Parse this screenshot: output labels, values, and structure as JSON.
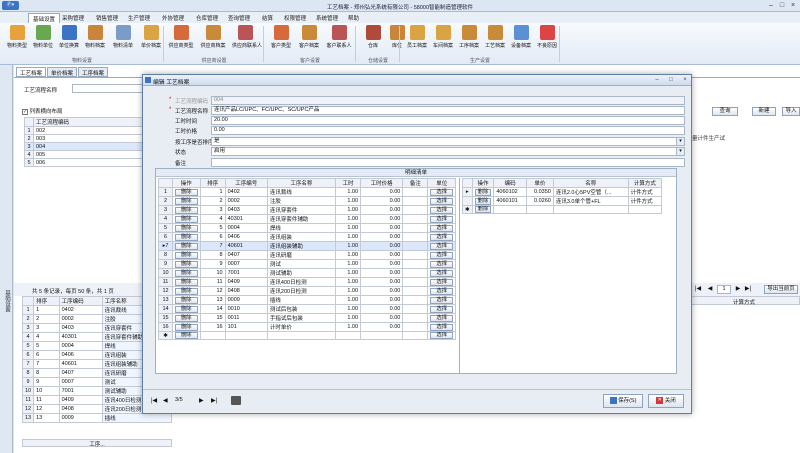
{
  "window": {
    "title": "工艺档案 - 郑州弘光系统有限公司 - 58000智能制造管理软件",
    "app_button": "Ⓟ▾"
  },
  "menubar": [
    {
      "label": "基础设置",
      "active": true
    },
    {
      "label": "采购管理"
    },
    {
      "label": "销售管理"
    },
    {
      "label": "生产管理"
    },
    {
      "label": "外协管理"
    },
    {
      "label": "仓库管理"
    },
    {
      "label": "查询管理"
    },
    {
      "label": "结算"
    },
    {
      "label": "权限管理"
    },
    {
      "label": "系统管理"
    },
    {
      "label": "帮助"
    }
  ],
  "ribbon": {
    "buttons": [
      {
        "label": "物料类型",
        "icon": "folder-icon",
        "color": "#e8a23a"
      },
      {
        "label": "物料单位",
        "icon": "unit-icon",
        "color": "#6aa84f"
      },
      {
        "label": "单位换算",
        "icon": "convert-icon",
        "color": "#3b74c4"
      },
      {
        "label": "物料档案",
        "icon": "archive-icon",
        "color": "#c9853a"
      },
      {
        "label": "物料清单",
        "icon": "list-icon",
        "color": "#7a9cc6"
      },
      {
        "label": "单价档案",
        "icon": "price-icon",
        "color": "#d9a441"
      },
      {
        "label": "供应商类型",
        "icon": "supplier-type-icon",
        "color": "#d66a3a"
      },
      {
        "label": "供应商档案",
        "icon": "supplier-icon",
        "color": "#c98a3a"
      },
      {
        "label": "供应商联系人",
        "icon": "contact-icon",
        "color": "#b55"
      },
      {
        "label": "客户类型",
        "icon": "customer-type-icon",
        "color": "#d66a3a"
      },
      {
        "label": "客户档案",
        "icon": "customer-icon",
        "color": "#c98a3a"
      },
      {
        "label": "客户联系人",
        "icon": "customer-contact-icon",
        "color": "#b55"
      },
      {
        "label": "仓库",
        "icon": "warehouse-icon",
        "color": "#b04a3a"
      },
      {
        "label": "库位",
        "icon": "location-icon",
        "color": "#c9853a"
      },
      {
        "label": "员工档案",
        "icon": "employee-icon",
        "color": "#d9a441"
      },
      {
        "label": "车间档案",
        "icon": "workshop-icon",
        "color": "#d9a441"
      },
      {
        "label": "工序档案",
        "icon": "process-icon",
        "color": "#c98a3a"
      },
      {
        "label": "工艺档案",
        "icon": "craft-icon",
        "color": "#c98a3a"
      },
      {
        "label": "设备档案",
        "icon": "equipment-icon",
        "color": "#5b8fd6"
      },
      {
        "label": "不良原因",
        "icon": "defect-icon",
        "color": "#d44"
      }
    ],
    "groups": [
      "物料设置",
      "供应商设置",
      "客户设置",
      "仓储设置",
      "生产设置"
    ]
  },
  "lefttab": "基础设置",
  "doc_tabs": [
    "工艺档案",
    "单价档案",
    "工序档案"
  ],
  "main": {
    "filter_label": "工艺流程名称",
    "show_all_label": "列表横向布局",
    "query_btn": "查询",
    "new_btn": "新建",
    "import_btn": "导入",
    "list_header": "工艺流程编码",
    "list_rows": [
      {
        "n": "1",
        "code": "002"
      },
      {
        "n": "2",
        "code": "003"
      },
      {
        "n": "3",
        "code": "004",
        "selected": true
      },
      {
        "n": "4",
        "code": "005"
      },
      {
        "n": "5",
        "code": "006"
      }
    ],
    "right_text": "量计件生产试",
    "pager_text": "共 5 条记录，每页 50 条，共 1 页",
    "page_num": "1",
    "export_btn": "导出当前页",
    "lower_headers": [
      "排序",
      "工序编码",
      "工序名称"
    ],
    "lower_rows": [
      {
        "n": "1",
        "seq": "1",
        "code": "0402",
        "name": "连讯裁线"
      },
      {
        "n": "2",
        "seq": "2",
        "code": "0002",
        "name": "注胶"
      },
      {
        "n": "3",
        "seq": "3",
        "code": "0403",
        "name": "连讯穿套件"
      },
      {
        "n": "4",
        "seq": "4",
        "code": "40301",
        "name": "连讯穿套件辅助"
      },
      {
        "n": "5",
        "seq": "5",
        "code": "0004",
        "name": "焊线"
      },
      {
        "n": "6",
        "seq": "6",
        "code": "0406",
        "name": "连讯组装"
      },
      {
        "n": "7",
        "seq": "7",
        "code": "40601",
        "name": "连讯组装辅助"
      },
      {
        "n": "8",
        "seq": "8",
        "code": "0407",
        "name": "连讯研磨"
      },
      {
        "n": "9",
        "seq": "9",
        "code": "0007",
        "name": "测试"
      },
      {
        "n": "10",
        "seq": "10",
        "code": "7001",
        "name": "测试辅助"
      },
      {
        "n": "11",
        "seq": "11",
        "code": "0409",
        "name": "连讯400日检测"
      },
      {
        "n": "12",
        "seq": "12",
        "code": "0408",
        "name": "连讯200日检测"
      },
      {
        "n": "13",
        "seq": "13",
        "code": "0009",
        "name": "插线"
      }
    ],
    "lower_right_header": "计算方式",
    "lower_footer": "工序..."
  },
  "modal": {
    "title": "编辑 工艺档案",
    "fields": {
      "code_label": "工艺流程编码",
      "code_value": "004",
      "name_label": "工艺流程名称",
      "name_value": "连讯产品LC/UPC、FC/UPC、SC/UPC产品",
      "time_label": "工时时间",
      "time_value": "20.00",
      "price_label": "工时价格",
      "price_value": "0.00",
      "sort_label": "按工序是否排序",
      "sort_value": "是",
      "status_label": "状态",
      "status_value": "启用",
      "remark_label": "备注",
      "remark_value": ""
    },
    "detail_title": "明细清单",
    "left_headers": [
      "操作",
      "排序",
      "工序编号",
      "工序名称",
      "工时",
      "工时价格",
      "备注",
      "单位"
    ],
    "left_rows": [
      {
        "n": "1",
        "op": "删除",
        "seq": "1",
        "code": "0402",
        "name": "连讯裁线",
        "hours": "1.00",
        "price": "0.00",
        "remark": "",
        "unit": "选择"
      },
      {
        "n": "2",
        "op": "删除",
        "seq": "2",
        "code": "0002",
        "name": "注胶",
        "hours": "1.00",
        "price": "0.00",
        "remark": "",
        "unit": "选择"
      },
      {
        "n": "3",
        "op": "删除",
        "seq": "3",
        "code": "0403",
        "name": "连讯穿套件",
        "hours": "1.00",
        "price": "0.00",
        "remark": "",
        "unit": "选择"
      },
      {
        "n": "4",
        "op": "删除",
        "seq": "4",
        "code": "40301",
        "name": "连讯穿套件辅助",
        "hours": "1.00",
        "price": "0.00",
        "remark": "",
        "unit": "选择"
      },
      {
        "n": "5",
        "op": "删除",
        "seq": "5",
        "code": "0004",
        "name": "焊线",
        "hours": "1.00",
        "price": "0.00",
        "remark": "",
        "unit": "选择"
      },
      {
        "n": "6",
        "op": "删除",
        "seq": "6",
        "code": "0406",
        "name": "连讯组装",
        "hours": "1.00",
        "price": "0.00",
        "remark": "",
        "unit": "选择"
      },
      {
        "n": "▸7",
        "op": "删除",
        "seq": "7",
        "code": "40601",
        "name": "连讯组装辅助",
        "hours": "1.00",
        "price": "0.00",
        "remark": "",
        "unit": "选择",
        "selected": true
      },
      {
        "n": "8",
        "op": "删除",
        "seq": "8",
        "code": "0407",
        "name": "连讯研磨",
        "hours": "1.00",
        "price": "0.00",
        "remark": "",
        "unit": "选择"
      },
      {
        "n": "9",
        "op": "删除",
        "seq": "9",
        "code": "0007",
        "name": "测试",
        "hours": "1.00",
        "price": "0.00",
        "remark": "",
        "unit": "选择"
      },
      {
        "n": "10",
        "op": "删除",
        "seq": "10",
        "code": "7001",
        "name": "测试辅助",
        "hours": "1.00",
        "price": "0.00",
        "remark": "",
        "unit": "选择"
      },
      {
        "n": "11",
        "op": "删除",
        "seq": "11",
        "code": "0409",
        "name": "连讯400日检测",
        "hours": "1.00",
        "price": "0.00",
        "remark": "",
        "unit": "选择"
      },
      {
        "n": "12",
        "op": "删除",
        "seq": "12",
        "code": "0408",
        "name": "连讯200日检测",
        "hours": "1.00",
        "price": "0.00",
        "remark": "",
        "unit": "选择"
      },
      {
        "n": "13",
        "op": "删除",
        "seq": "13",
        "code": "0009",
        "name": "插线",
        "hours": "1.00",
        "price": "0.00",
        "remark": "",
        "unit": "选择"
      },
      {
        "n": "14",
        "op": "删除",
        "seq": "14",
        "code": "0010",
        "name": "测试后包装",
        "hours": "1.00",
        "price": "0.00",
        "remark": "",
        "unit": "选择"
      },
      {
        "n": "15",
        "op": "删除",
        "seq": "15",
        "code": "0011",
        "name": "手指试后包装",
        "hours": "1.00",
        "price": "0.00",
        "remark": "",
        "unit": "选择"
      },
      {
        "n": "16",
        "op": "删除",
        "seq": "16",
        "code": "101",
        "name": "计时单价",
        "hours": "1.00",
        "price": "0.00",
        "remark": "",
        "unit": "选择"
      },
      {
        "n": "✱",
        "op": "删除",
        "seq": "",
        "code": "",
        "name": "",
        "hours": "",
        "price": "",
        "remark": "",
        "unit": "选择"
      }
    ],
    "right_headers": [
      "操作",
      "编码",
      "单价",
      "名称",
      "计算方式"
    ],
    "right_rows": [
      {
        "n": "▸",
        "op": "删除",
        "code": "4060102",
        "price": "0.0350",
        "name": "连讯2.0心5PV空管（...",
        "calc": "计件方式"
      },
      {
        "n": "",
        "op": "删除",
        "code": "4060101",
        "price": "0.0260",
        "name": "连讯3.0单个管+FL",
        "calc": "计件方式"
      },
      {
        "n": "✱",
        "op": "删除",
        "code": "",
        "price": "",
        "name": "",
        "calc": ""
      }
    ],
    "nav": {
      "first": "|◀",
      "prev": "◀",
      "position": "3/5",
      "next": "▶",
      "last": "▶|"
    },
    "save_btn": "保存(S)",
    "close_btn": "关闭"
  }
}
